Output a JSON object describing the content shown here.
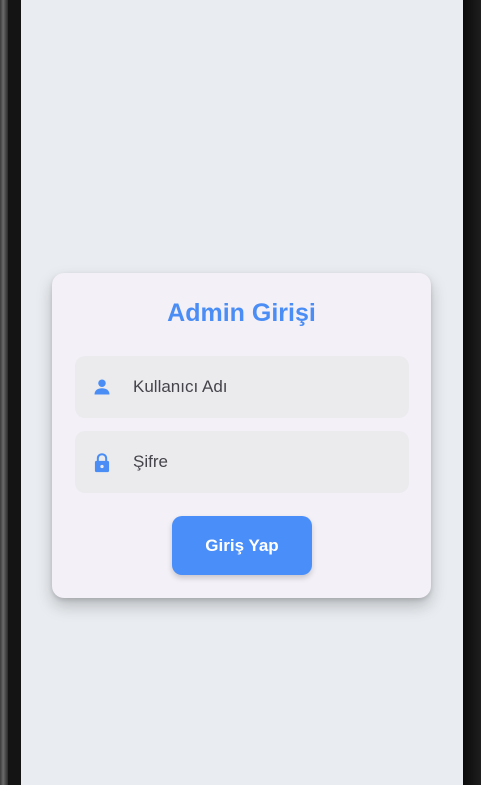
{
  "card": {
    "title": "Admin Girişi"
  },
  "form": {
    "username_label": "Kullanıcı Adı",
    "password_label": "Şifre",
    "submit_label": "Giriş Yap"
  },
  "icons": {
    "username": "person-icon",
    "password": "lock-icon"
  },
  "colors": {
    "accent": "#4a8ef5",
    "screen_background": "#e9edf1",
    "card_background": "#f4f0f8",
    "field_background": "#ebebee"
  }
}
